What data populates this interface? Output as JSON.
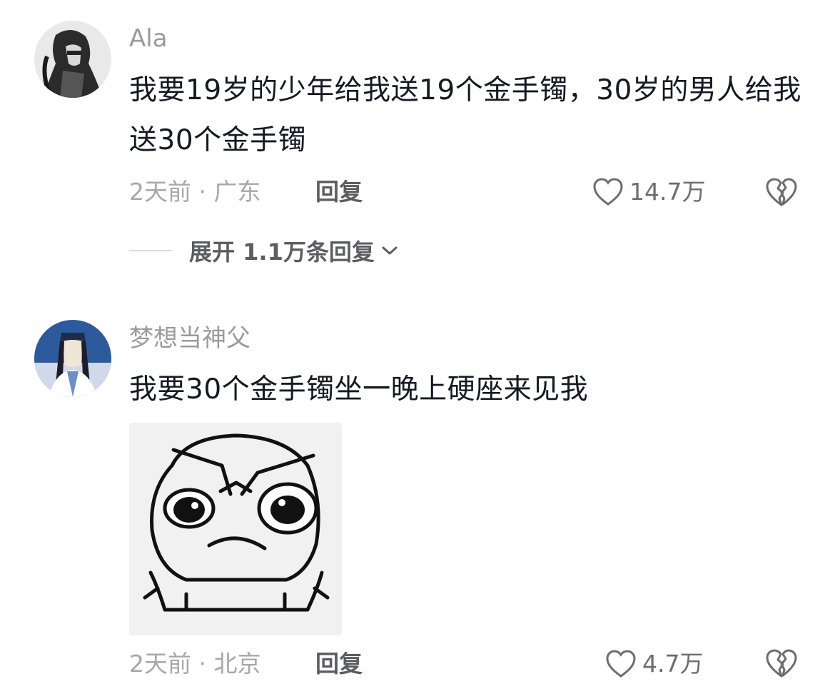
{
  "comments": [
    {
      "username": "Ala",
      "text": "我要19岁的少年给我送19个金手镯，30岁的男人给我送30个金手镯",
      "meta": "2天前 · 广东",
      "reply_label": "回复",
      "likes": "14.7万",
      "expand_label": "展开 1.1万条回复"
    },
    {
      "username": "梦想当神父",
      "text": "我要30个金手镯坐一晚上硬座来见我",
      "meta": "2天前 · 北京",
      "reply_label": "回复",
      "likes": "4.7万"
    }
  ],
  "icons": {
    "like": "heart-outline-icon",
    "dislike": "broken-heart-icon",
    "expand": "chevron-down-icon"
  },
  "colors": {
    "text": "#161823",
    "muted": "#a7a7ac",
    "username": "#9a9aa0"
  }
}
